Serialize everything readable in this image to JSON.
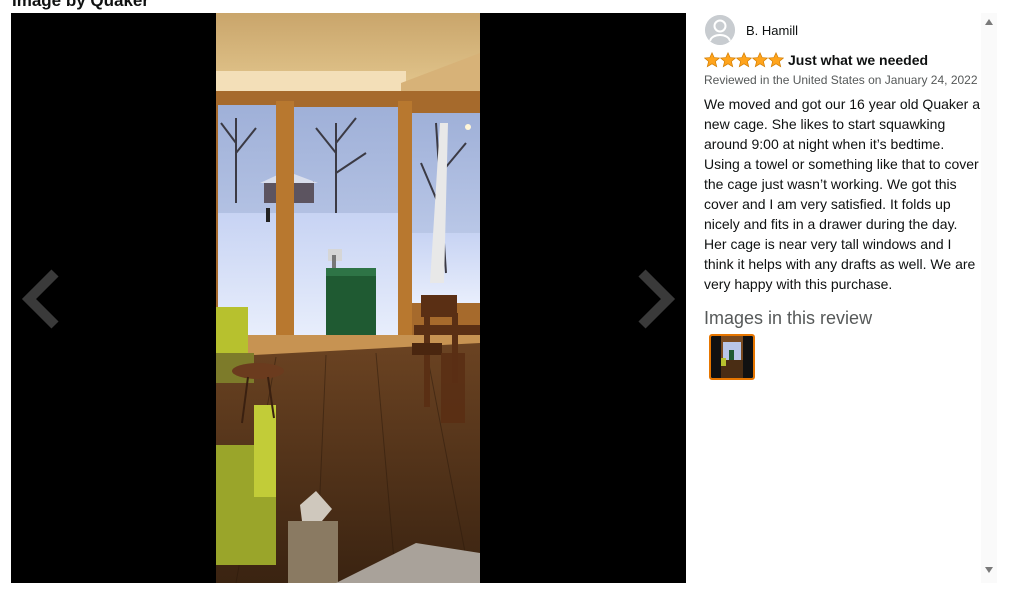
{
  "header": {
    "clipped_title": "Image by Quaker"
  },
  "viewer": {
    "prev_icon": "chevron-left-icon",
    "next_icon": "chevron-right-icon",
    "image_subject": "room with large windows overlooking snowy yard, covered bird cage"
  },
  "review": {
    "reviewer_name": "B. Hamill",
    "rating": 5,
    "rating_max": 5,
    "star_color": "#ffa41c",
    "title": "Just what we needed",
    "meta": "Reviewed in the United States on January 24, 2022",
    "body": "We moved and got our 16 year old Quaker a new cage. She likes to start squawking around 9:00 at night when it’s bedtime. Using a towel or something like that to cover the cage just wasn’t working. We got this cover and I am very satisfied. It folds up nicely and fits in a drawer during the day. Her cage is near very tall windows and I think it helps with any drafts as well. We are very happy with this purchase.",
    "images_heading": "Images in this review",
    "thumb_border_color": "#e77600"
  },
  "scrollbar": {
    "up_icon": "scroll-up-arrow-icon",
    "down_icon": "scroll-down-arrow-icon"
  }
}
